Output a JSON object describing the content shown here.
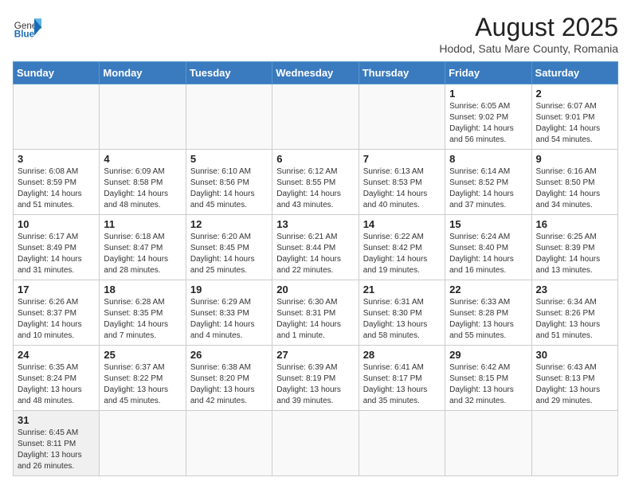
{
  "logo": {
    "text_general": "General",
    "text_blue": "Blue"
  },
  "title": "August 2025",
  "subtitle": "Hodod, Satu Mare County, Romania",
  "weekdays": [
    "Sunday",
    "Monday",
    "Tuesday",
    "Wednesday",
    "Thursday",
    "Friday",
    "Saturday"
  ],
  "weeks": [
    [
      {
        "day": "",
        "info": ""
      },
      {
        "day": "",
        "info": ""
      },
      {
        "day": "",
        "info": ""
      },
      {
        "day": "",
        "info": ""
      },
      {
        "day": "",
        "info": ""
      },
      {
        "day": "1",
        "info": "Sunrise: 6:05 AM\nSunset: 9:02 PM\nDaylight: 14 hours and 56 minutes."
      },
      {
        "day": "2",
        "info": "Sunrise: 6:07 AM\nSunset: 9:01 PM\nDaylight: 14 hours and 54 minutes."
      }
    ],
    [
      {
        "day": "3",
        "info": "Sunrise: 6:08 AM\nSunset: 8:59 PM\nDaylight: 14 hours and 51 minutes."
      },
      {
        "day": "4",
        "info": "Sunrise: 6:09 AM\nSunset: 8:58 PM\nDaylight: 14 hours and 48 minutes."
      },
      {
        "day": "5",
        "info": "Sunrise: 6:10 AM\nSunset: 8:56 PM\nDaylight: 14 hours and 45 minutes."
      },
      {
        "day": "6",
        "info": "Sunrise: 6:12 AM\nSunset: 8:55 PM\nDaylight: 14 hours and 43 minutes."
      },
      {
        "day": "7",
        "info": "Sunrise: 6:13 AM\nSunset: 8:53 PM\nDaylight: 14 hours and 40 minutes."
      },
      {
        "day": "8",
        "info": "Sunrise: 6:14 AM\nSunset: 8:52 PM\nDaylight: 14 hours and 37 minutes."
      },
      {
        "day": "9",
        "info": "Sunrise: 6:16 AM\nSunset: 8:50 PM\nDaylight: 14 hours and 34 minutes."
      }
    ],
    [
      {
        "day": "10",
        "info": "Sunrise: 6:17 AM\nSunset: 8:49 PM\nDaylight: 14 hours and 31 minutes."
      },
      {
        "day": "11",
        "info": "Sunrise: 6:18 AM\nSunset: 8:47 PM\nDaylight: 14 hours and 28 minutes."
      },
      {
        "day": "12",
        "info": "Sunrise: 6:20 AM\nSunset: 8:45 PM\nDaylight: 14 hours and 25 minutes."
      },
      {
        "day": "13",
        "info": "Sunrise: 6:21 AM\nSunset: 8:44 PM\nDaylight: 14 hours and 22 minutes."
      },
      {
        "day": "14",
        "info": "Sunrise: 6:22 AM\nSunset: 8:42 PM\nDaylight: 14 hours and 19 minutes."
      },
      {
        "day": "15",
        "info": "Sunrise: 6:24 AM\nSunset: 8:40 PM\nDaylight: 14 hours and 16 minutes."
      },
      {
        "day": "16",
        "info": "Sunrise: 6:25 AM\nSunset: 8:39 PM\nDaylight: 14 hours and 13 minutes."
      }
    ],
    [
      {
        "day": "17",
        "info": "Sunrise: 6:26 AM\nSunset: 8:37 PM\nDaylight: 14 hours and 10 minutes."
      },
      {
        "day": "18",
        "info": "Sunrise: 6:28 AM\nSunset: 8:35 PM\nDaylight: 14 hours and 7 minutes."
      },
      {
        "day": "19",
        "info": "Sunrise: 6:29 AM\nSunset: 8:33 PM\nDaylight: 14 hours and 4 minutes."
      },
      {
        "day": "20",
        "info": "Sunrise: 6:30 AM\nSunset: 8:31 PM\nDaylight: 14 hours and 1 minute."
      },
      {
        "day": "21",
        "info": "Sunrise: 6:31 AM\nSunset: 8:30 PM\nDaylight: 13 hours and 58 minutes."
      },
      {
        "day": "22",
        "info": "Sunrise: 6:33 AM\nSunset: 8:28 PM\nDaylight: 13 hours and 55 minutes."
      },
      {
        "day": "23",
        "info": "Sunrise: 6:34 AM\nSunset: 8:26 PM\nDaylight: 13 hours and 51 minutes."
      }
    ],
    [
      {
        "day": "24",
        "info": "Sunrise: 6:35 AM\nSunset: 8:24 PM\nDaylight: 13 hours and 48 minutes."
      },
      {
        "day": "25",
        "info": "Sunrise: 6:37 AM\nSunset: 8:22 PM\nDaylight: 13 hours and 45 minutes."
      },
      {
        "day": "26",
        "info": "Sunrise: 6:38 AM\nSunset: 8:20 PM\nDaylight: 13 hours and 42 minutes."
      },
      {
        "day": "27",
        "info": "Sunrise: 6:39 AM\nSunset: 8:19 PM\nDaylight: 13 hours and 39 minutes."
      },
      {
        "day": "28",
        "info": "Sunrise: 6:41 AM\nSunset: 8:17 PM\nDaylight: 13 hours and 35 minutes."
      },
      {
        "day": "29",
        "info": "Sunrise: 6:42 AM\nSunset: 8:15 PM\nDaylight: 13 hours and 32 minutes."
      },
      {
        "day": "30",
        "info": "Sunrise: 6:43 AM\nSunset: 8:13 PM\nDaylight: 13 hours and 29 minutes."
      }
    ],
    [
      {
        "day": "31",
        "info": "Sunrise: 6:45 AM\nSunset: 8:11 PM\nDaylight: 13 hours and 26 minutes."
      },
      {
        "day": "",
        "info": ""
      },
      {
        "day": "",
        "info": ""
      },
      {
        "day": "",
        "info": ""
      },
      {
        "day": "",
        "info": ""
      },
      {
        "day": "",
        "info": ""
      },
      {
        "day": "",
        "info": ""
      }
    ]
  ]
}
